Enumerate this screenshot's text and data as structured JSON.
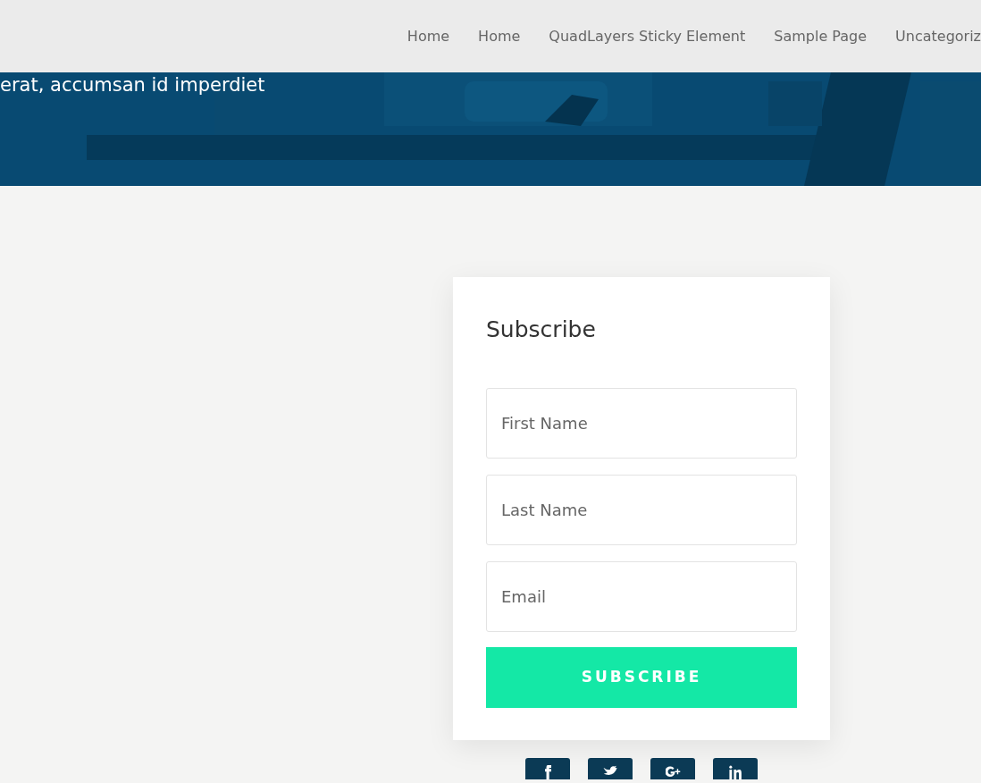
{
  "nav": {
    "items": [
      {
        "label": "Home"
      },
      {
        "label": "Home"
      },
      {
        "label": "QuadLayers Sticky Element"
      },
      {
        "label": "Sample Page"
      },
      {
        "label": "Uncategoriz"
      }
    ]
  },
  "hero": {
    "text": "erat, accumsan id imperdiet"
  },
  "subscribe": {
    "title": "Subscribe",
    "fields": [
      {
        "placeholder": "First Name"
      },
      {
        "placeholder": "Last Name"
      },
      {
        "placeholder": "Email"
      }
    ],
    "button": "SUBSCRIBE"
  },
  "social": [
    {
      "kind": "facebook"
    },
    {
      "kind": "twitter"
    },
    {
      "kind": "google-plus"
    },
    {
      "kind": "linkedin"
    }
  ]
}
